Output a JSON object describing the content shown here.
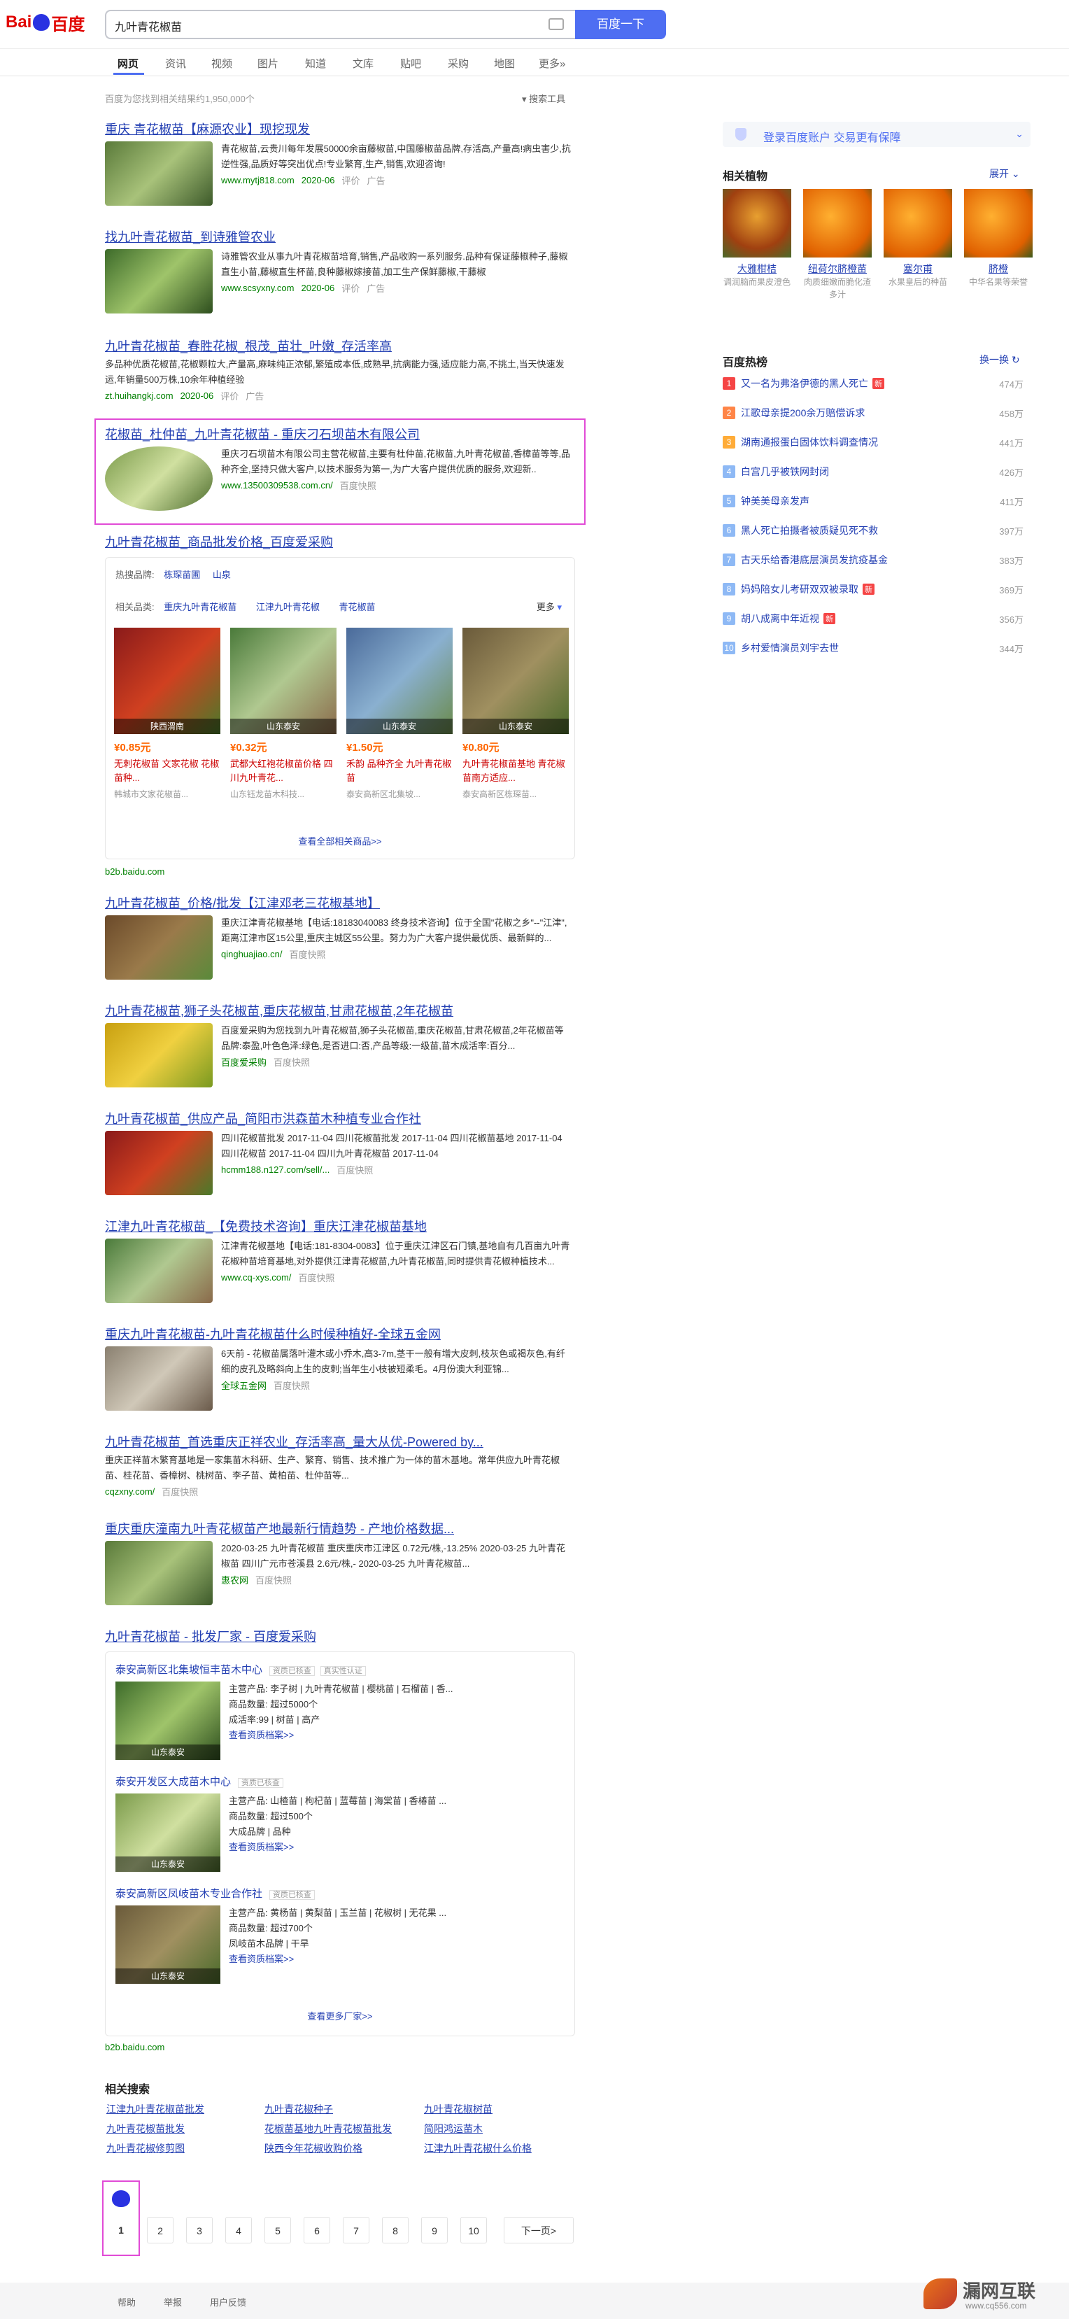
{
  "header": {
    "logo_left": "Bai",
    "logo_right": "百度",
    "query": "九叶青花椒苗",
    "search_btn": "百度一下"
  },
  "tabs": [
    "网页",
    "资讯",
    "视频",
    "图片",
    "知道",
    "文库",
    "贴吧",
    "采购",
    "地图",
    "更多»"
  ],
  "result_count": "百度为您找到相关结果约1,950,000个",
  "search_tools": "搜索工具",
  "r1": {
    "title": "重庆 青花椒苗【麻源农业】现挖现发",
    "snippet": "青花椒苗,云贵川每年发展50000余亩藤椒苗,中国藤椒苗品牌,存活高,产量高!病虫害少,抗逆性强,品质好等突出优点!专业繁育,生产,销售,欢迎咨询!",
    "url": "www.mytj818.com",
    "date": "2020-06",
    "rate": "评价",
    "ad": "广告"
  },
  "r2": {
    "title": "找九叶青花椒苗_到诗雅管农业",
    "snippet": "诗雅管农业从事九叶青花椒苗培育,销售,产品收购一系列服务.品种有保证藤椒种子,藤椒直生小苗,藤椒直生杯苗,良种藤椒嫁接苗,加工生产保鲜藤椒,干藤椒",
    "url": "www.scsyxny.com",
    "date": "2020-06",
    "rate": "评价",
    "ad": "广告"
  },
  "r3": {
    "title": "九叶青花椒苗_春胜花椒_根茂_苗壮_叶嫩_存活率高",
    "snippet": "多品种优质花椒苗,花椒颗粒大,产量高,麻味纯正浓郁,繁殖成本低,成熟早,抗病能力强,适应能力高,不挑土,当天快速发运,年销量500万株,10余年种植经验",
    "url": "zt.huihangkj.com",
    "date": "2020-06",
    "rate": "评价",
    "ad": "广告"
  },
  "r4": {
    "title": "花椒苗_杜仲苗_九叶青花椒苗 - 重庆刁石坝苗木有限公司",
    "snippet": "重庆刁石坝苗木有限公司主营花椒苗,主要有杜仲苗,花椒苗,九叶青花椒苗,香樟苗等等,品种齐全,坚持只做大客户,以技术服务为第一,为广大客户提供优质的服务,欢迎新..",
    "url": "www.13500309538.com.cn/",
    "snap": "百度快照"
  },
  "r5": {
    "title": "九叶青花椒苗_商品批发价格_百度爱采购",
    "hot_label": "热搜品牌:",
    "hot_brands": [
      "栋琛苗圃",
      "山泉"
    ],
    "related_label": "相关品类:",
    "related": [
      "重庆九叶青花椒苗",
      "江津九叶青花椒",
      "青花椒苗"
    ],
    "more": "更多",
    "products": [
      {
        "loc": "陕西渭南",
        "price": "¥0.85元",
        "title": "无刺花椒苗 文家花椒 花椒苗种...",
        "seller": "韩城市文家花椒苗..."
      },
      {
        "loc": "山东泰安",
        "price": "¥0.32元",
        "title": "武都大红袍花椒苗价格 四川九叶青花...",
        "seller": "山东钰龙苗木科技..."
      },
      {
        "loc": "山东泰安",
        "price": "¥1.50元",
        "title": "禾韵 品种齐全 九叶青花椒苗",
        "seller": "泰安高新区北集坡..."
      },
      {
        "loc": "山东泰安",
        "price": "¥0.80元",
        "title": "九叶青花椒苗基地 青花椒苗南方适应...",
        "seller": "泰安高新区栋琛苗..."
      }
    ],
    "view_all": "查看全部相关商品>>",
    "footer_url": "b2b.baidu.com"
  },
  "r6": {
    "title": "九叶青花椒苗_价格/批发【江津邓老三花椒基地】",
    "snippet": "重庆江津青花椒基地【电话:18183040083 终身技术咨询】位于全国\"花椒之乡\"--\"江津\",距离江津市区15公里,重庆主城区55公里。努力为广大客户提供最优质、最新鲜的...",
    "url": "qinghuajiao.cn/",
    "snap": "百度快照"
  },
  "r7": {
    "title": "九叶青花椒苗,狮子头花椒苗,重庆花椒苗,甘肃花椒苗,2年花椒苗",
    "snippet": "百度爱采购为您找到九叶青花椒苗,狮子头花椒苗,重庆花椒苗,甘肃花椒苗,2年花椒苗等品牌:泰盈,叶色色泽:绿色,是否进口:否,产品等级:一级苗,苗木成活率:百分...",
    "url": "百度爱采购",
    "snap": "百度快照"
  },
  "r8": {
    "title": "九叶青花椒苗_供应产品_简阳市洪森苗木种植专业合作社",
    "snippet": "四川花椒苗批发 2017-11-04 四川花椒苗批发 2017-11-04 四川花椒苗基地 2017-11-04 四川花椒苗 2017-11-04 四川九叶青花椒苗 2017-11-04",
    "url": "hcmm188.n127.com/sell/...",
    "snap": "百度快照"
  },
  "r9": {
    "title": "江津九叶青花椒苗_【免费技术咨询】重庆江津花椒苗基地",
    "snippet": "江津青花椒基地【电话:181-8304-0083】位于重庆江津区石门镇,基地自有几百亩九叶青花椒种苗培育基地,对外提供江津青花椒苗,九叶青花椒苗,同时提供青花椒种植技术...",
    "url": "www.cq-xys.com/",
    "snap": "百度快照"
  },
  "r10": {
    "title": "重庆九叶青花椒苗-九叶青花椒苗什么时候种植好-全球五金网",
    "snippet": "6天前 - 花椒苗属落叶灌木或小乔木,高3-7m,茎干一般有增大皮刺,枝灰色或褐灰色,有纤细的皮孔及略斜向上生的皮刺;当年生小枝被短柔毛。4月份澳大利亚锦...",
    "url": "全球五金网",
    "snap": "百度快照"
  },
  "r11": {
    "title": "九叶青花椒苗_首选重庆正祥农业_存活率高_量大从优-Powered by...",
    "snippet": "重庆正祥苗木繁育基地是一家集苗木科研、生产、繁育、销售、技术推广为一体的苗木基地。常年供应九叶青花椒苗、桂花苗、香樟树、桃树苗、李子苗、黄柏苗、杜仲苗等...",
    "url": "cqzxny.com/",
    "snap": "百度快照"
  },
  "r12": {
    "title": "重庆重庆潼南九叶青花椒苗产地最新行情趋势 - 产地价格数据...",
    "snippet": "2020-03-25 九叶青花椒苗 重庆重庆市江津区 0.72元/株,-13.25% 2020-03-25 九叶青花椒苗 四川广元市苍溪县 2.6元/株,- 2020-03-25 九叶青花椒苗...",
    "url": "惠农网",
    "snap": "百度快照"
  },
  "r13": {
    "title": "九叶青花椒苗 - 批发厂家 - 百度爱采购",
    "badge1": "资质已核查",
    "badge2": "真实性认证",
    "shops": [
      {
        "name": "泰安高新区北集坡恒丰苗木中心",
        "badge": "资质已核查",
        "main": "主营产品: 李子树 | 九叶青花椒苗 | 樱桃苗 | 石榴苗 | 香...",
        "qty": "商品数量: 超过5000个",
        "extra": "成活率:99 | 树苗 | 高产",
        "link": "查看资质档案>>",
        "loc": "山东泰安"
      },
      {
        "name": "泰安开发区大成苗木中心",
        "badge": "资质已核查",
        "main": "主营产品: 山楂苗 | 枸杞苗 | 蓝莓苗 | 海棠苗 | 香椿苗 ...",
        "qty": "商品数量: 超过500个",
        "extra": "大成品牌 | 品种",
        "link": "查看资质档案>>",
        "loc": "山东泰安"
      },
      {
        "name": "泰安高新区凤岐苗木专业合作社",
        "badge": "资质已核查",
        "main": "主营产品: 黄杨苗 | 黄梨苗 | 玉兰苗 | 花椒树 | 无花果 ...",
        "qty": "商品数量: 超过700个",
        "extra": "凤岐苗木品牌 | 干旱",
        "link": "查看资质档案>>",
        "loc": "山东泰安"
      }
    ],
    "view_more": "查看更多厂家>>",
    "footer_url": "b2b.baidu.com"
  },
  "related": {
    "title": "相关搜索",
    "items": [
      "江津九叶青花椒苗批发",
      "九叶青花椒种子",
      "九叶青花椒树苗",
      "九叶青花椒苗批发",
      "花椒苗基地九叶青花椒苗批发",
      "简阳鸿运苗木",
      "九叶青花椒修剪图",
      "陕西今年花椒收购价格",
      "江津九叶青花椒什么价格"
    ]
  },
  "pagination": {
    "pages": [
      "1",
      "2",
      "3",
      "4",
      "5",
      "6",
      "7",
      "8",
      "9",
      "10"
    ],
    "next": "下一页>"
  },
  "footer": {
    "links": [
      "帮助",
      "举报",
      "用户反馈"
    ],
    "watermark": "漏网互联",
    "watermark_url": "www.cq556.com"
  },
  "right": {
    "login": "登录百度账户 交易更有保障",
    "plants_title": "相关植物",
    "expand": "展开",
    "plants": [
      {
        "name": "大雅柑桔",
        "desc": "调润脑而果皮澄色"
      },
      {
        "name": "纽荷尔脐橙苗",
        "desc": "肉质细嫩而脆化渣多汁"
      },
      {
        "name": "塞尔甫",
        "desc": "水果皇后的种苗"
      },
      {
        "name": "脐橙",
        "desc": "中华名果等荣誉"
      }
    ],
    "hot_title": "百度热榜",
    "refresh": "换一换",
    "hot": [
      {
        "r": "1",
        "t": "又一名为弗洛伊德的黑人死亡",
        "v": "474万",
        "n": "新"
      },
      {
        "r": "2",
        "t": "江歌母亲提200余万赔偿诉求",
        "v": "458万",
        "n": ""
      },
      {
        "r": "3",
        "t": "湖南通报蛋白固体饮料调查情况",
        "v": "441万",
        "n": ""
      },
      {
        "r": "4",
        "t": "白宫几乎被铁网封闭",
        "v": "426万",
        "n": ""
      },
      {
        "r": "5",
        "t": "钟美美母亲发声",
        "v": "411万",
        "n": ""
      },
      {
        "r": "6",
        "t": "黑人死亡拍摄者被质疑见死不救",
        "v": "397万",
        "n": ""
      },
      {
        "r": "7",
        "t": "古天乐给香港底层演员发抗疫基金",
        "v": "383万",
        "n": ""
      },
      {
        "r": "8",
        "t": "妈妈陪女儿考研双双被录取",
        "v": "369万",
        "n": "新"
      },
      {
        "r": "9",
        "t": "胡八成离中年近视",
        "v": "356万",
        "n": "新"
      },
      {
        "r": "10",
        "t": "乡村爱情演员刘宇去世",
        "v": "344万",
        "n": ""
      }
    ]
  },
  "colors": {
    "brand": "#4e6ef2",
    "link": "#2440b3",
    "red": "#c00",
    "green": "#008000",
    "highlight_box": "#e14bd6"
  }
}
